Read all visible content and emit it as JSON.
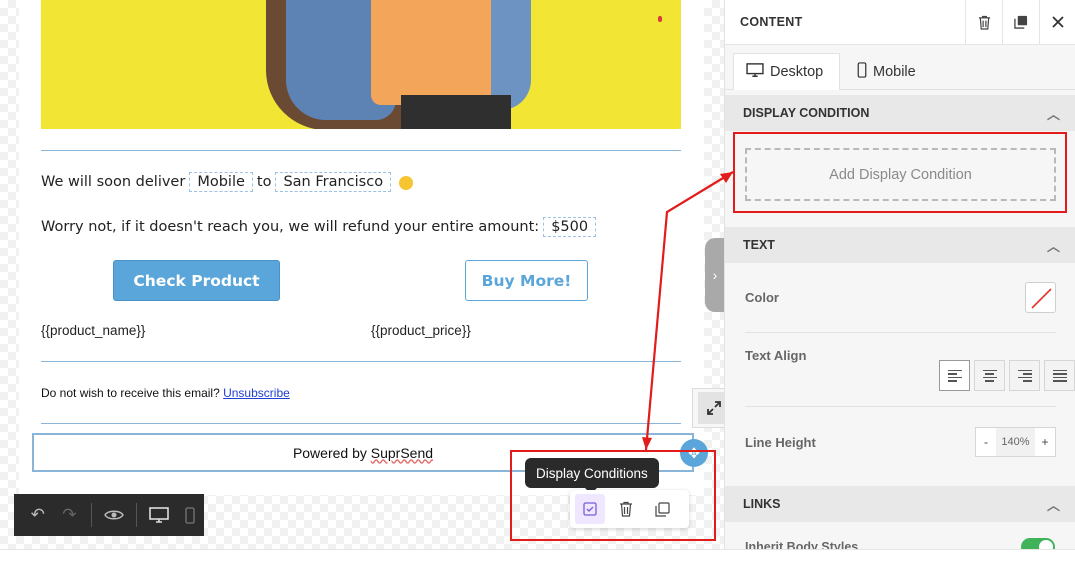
{
  "email": {
    "deliver_prefix": "We will soon deliver",
    "deliver_item": "Mobile",
    "deliver_to": "to",
    "deliver_city": "San Francisco",
    "refund_text": "Worry not, if it doesn't reach you, we will refund your entire amount:",
    "refund_amount": "$500",
    "check_product_label": "Check Product",
    "buy_more_label": "Buy More!",
    "product_name_var": "{{product_name}}",
    "product_price_var": "{{product_price}}",
    "unsubscribe_prefix": "Do not wish to receive this email?",
    "unsubscribe_link": "Unsubscribe",
    "powered_by_prefix": "Powered by",
    "powered_by_brand": "SuprSend"
  },
  "floating_toolbar": {
    "tooltip": "Display Conditions",
    "icons": [
      "display-condition-icon",
      "trash-icon",
      "duplicate-icon"
    ]
  },
  "bottom_controls": {
    "icons": [
      "undo-icon",
      "redo-icon",
      "preview-eye-icon",
      "desktop-icon",
      "mobile-icon"
    ]
  },
  "panel": {
    "title": "CONTENT",
    "header_icons": [
      "trash-icon",
      "duplicate-icon",
      "close-icon"
    ],
    "tabs": [
      {
        "label": "Desktop",
        "icon": "desktop-icon",
        "active": true
      },
      {
        "label": "Mobile",
        "icon": "mobile-icon",
        "active": false
      }
    ],
    "display_condition": {
      "heading": "DISPLAY CONDITION",
      "add_label": "Add Display Condition"
    },
    "text_section": {
      "heading": "TEXT",
      "color_label": "Color",
      "align_label": "Text Align",
      "align_options": [
        "left",
        "center",
        "right",
        "justify"
      ],
      "align_selected": "left",
      "line_height_label": "Line Height",
      "line_height_value": "140%",
      "minus": "-",
      "plus": "+"
    },
    "links_section": {
      "heading": "LINKS",
      "inherit_label": "Inherit Body Styles",
      "inherit_on": true
    }
  },
  "colors": {
    "accent": "#5aa6da",
    "annotation": "#e21b1b",
    "hero_background": "#f2e534",
    "toggle_on": "#40b35a"
  }
}
